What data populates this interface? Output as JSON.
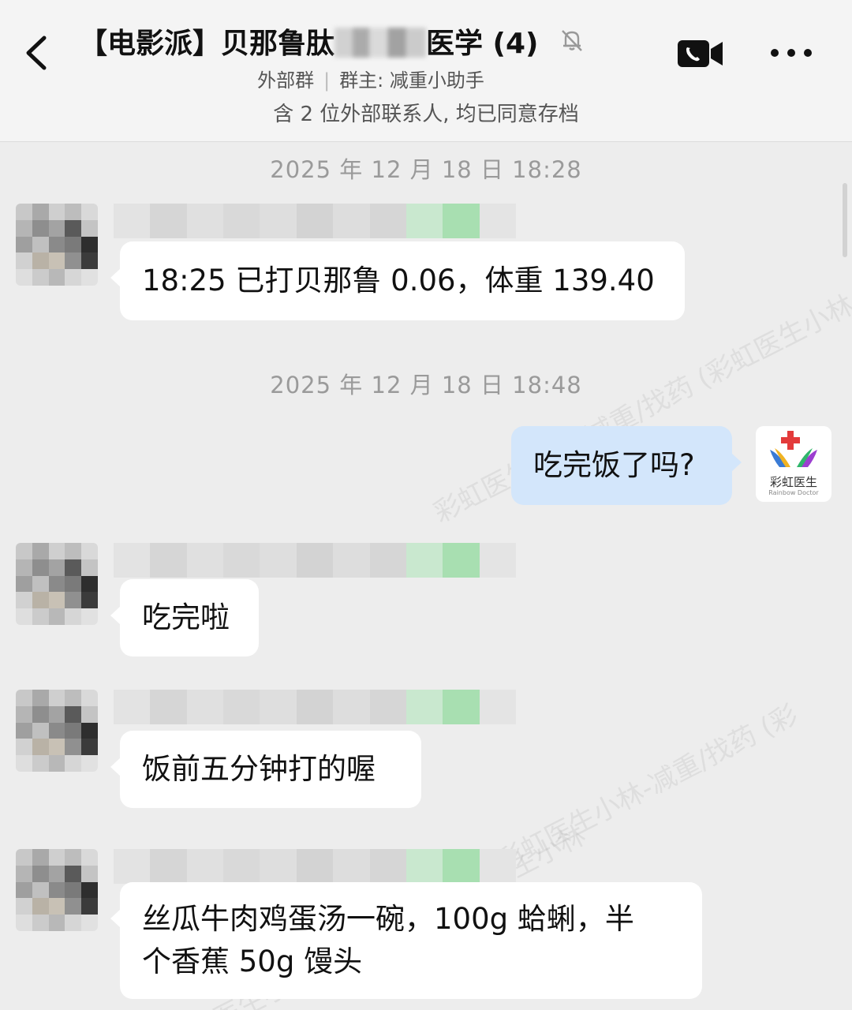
{
  "header": {
    "title_prefix": "【电影派】贝那鲁肽",
    "title_suffix": "医学 (4)",
    "group_type": "外部群",
    "owner": "群主: 减重小助手",
    "notice": "含 2 位外部联系人, 均已同意存档"
  },
  "messages": {
    "time1": "2025 年 12 月 18 日 18:28",
    "m1": "18:25 已打贝那鲁 0.06，体重 139.40",
    "time2": "2025 年 12 月 18 日 18:48",
    "m2": "吃完饭了吗?",
    "m3": "吃完啦",
    "m4": "饭前五分钟打的喔",
    "m5_line1": "丝瓜牛肉鸡蛋汤一碗，100g 蛤蜊，半",
    "m5_line2": "个香蕉 50g 馒头"
  },
  "right_avatar": {
    "name_cn": "彩虹医生",
    "name_en": "Rainbow Doctor"
  },
  "watermark": {
    "w1": "彩虹医生小林-减重/找药 (彩虹医生小林",
    "w2": "彩虹医生小林-减重/找药 (彩",
    "w3": "彩虹医生小林-减重/找药 (彩虹医生小林"
  },
  "colors": {
    "background": "#ededed",
    "bubble_left": "#ffffff",
    "bubble_right": "#d3e6fb",
    "timestamp": "#9a9a9a"
  },
  "icons": [
    "back-arrow-icon",
    "mute-bell-icon",
    "video-call-icon",
    "more-dots-icon"
  ]
}
